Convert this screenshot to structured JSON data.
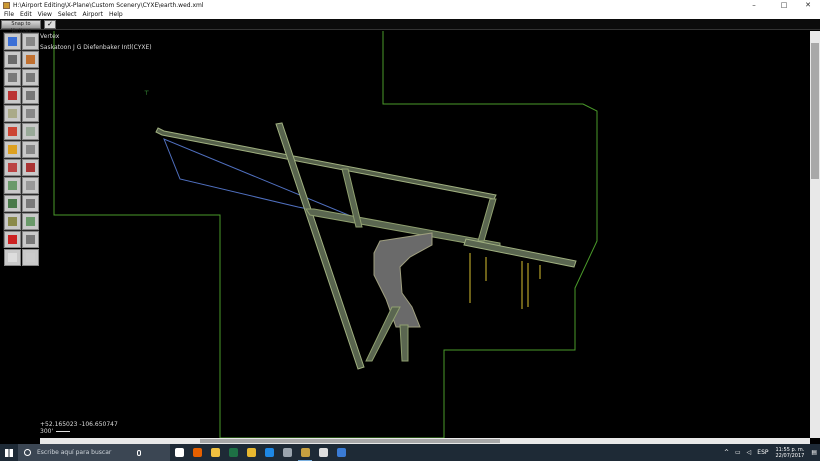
{
  "window": {
    "title": "H:\\Airport Editing\\X-Plane\\Custom Scenery\\CYXE\\earth.wed.xml",
    "minimize": "–",
    "maximize": "□",
    "close": "✕"
  },
  "menu": [
    "File",
    "Edit",
    "View",
    "Select",
    "Airport",
    "Help"
  ],
  "toolbar": {
    "snap_label": "Snap to Vertices",
    "snap_checked": "✓"
  },
  "tools": [
    {
      "name": "marquee-tool",
      "color": "#3b6fd6"
    },
    {
      "name": "vertex-tool",
      "color": "#888888"
    },
    {
      "name": "taxiway-tool",
      "color": "#6a6a6a"
    },
    {
      "name": "boundary-tool",
      "color": "#c07030"
    },
    {
      "name": "runway-tool",
      "color": "#7a7a7a"
    },
    {
      "name": "sealane-tool",
      "color": "#7a7a7a"
    },
    {
      "name": "helipad-tool",
      "color": "#b33"
    },
    {
      "name": "light-tool",
      "color": "#777"
    },
    {
      "name": "sign-tool",
      "color": "#aa8"
    },
    {
      "name": "windsock-tool",
      "color": "#888"
    },
    {
      "name": "beacon-tool",
      "color": "#c43"
    },
    {
      "name": "tower-tool",
      "color": "#9a9"
    },
    {
      "name": "line-marking-tool",
      "color": "#dda020"
    },
    {
      "name": "ramp-start-tool",
      "color": "#888"
    },
    {
      "name": "light-fixture-tool",
      "color": "#b44"
    },
    {
      "name": "polygon-tool",
      "color": "#a33"
    },
    {
      "name": "forest-tool",
      "color": "#6a9a6a"
    },
    {
      "name": "line-tool",
      "color": "#999"
    },
    {
      "name": "obj-tool",
      "color": "#4a7a4a"
    },
    {
      "name": "string-tool",
      "color": "#7a7a7a"
    },
    {
      "name": "polygon-draw-tool",
      "color": "#8a8a4a"
    },
    {
      "name": "exclusion-tool",
      "color": "#6a9a6a"
    },
    {
      "name": "delete-tool",
      "color": "#cc2222"
    },
    {
      "name": "taxi-route-tool",
      "color": "#777"
    },
    {
      "name": "truck-tool",
      "color": "#ddd"
    },
    {
      "name": "parking-tool",
      "color": "#ccc"
    }
  ],
  "map": {
    "mode_label": "Vertex",
    "airport_name": "Saskatoon J G Diefenbaker Intl(CYXE)",
    "coordinates": "+52.165023 -106.650747",
    "scale_label": "300'"
  },
  "taskbar": {
    "search_placeholder": "Escribe aquí para buscar",
    "apps": [
      {
        "name": "task-view-icon",
        "color": "#ffffff"
      },
      {
        "name": "firefox-icon",
        "color": "#e66000"
      },
      {
        "name": "file-explorer-icon",
        "color": "#f0c040"
      },
      {
        "name": "excel-icon",
        "color": "#1e7145"
      },
      {
        "name": "file-explorer-folder-icon",
        "color": "#e8b830"
      },
      {
        "name": "edge-icon",
        "color": "#1e88e5"
      },
      {
        "name": "xplane-icon",
        "color": "#9aa4ae"
      },
      {
        "name": "wed-icon",
        "color": "#c8a040"
      },
      {
        "name": "chrome-icon",
        "color": "#dddddd"
      },
      {
        "name": "paint-icon",
        "color": "#3a7bd5"
      }
    ],
    "language": "ESP",
    "time": "11:55 p. m.",
    "date": "22/07/2017"
  }
}
